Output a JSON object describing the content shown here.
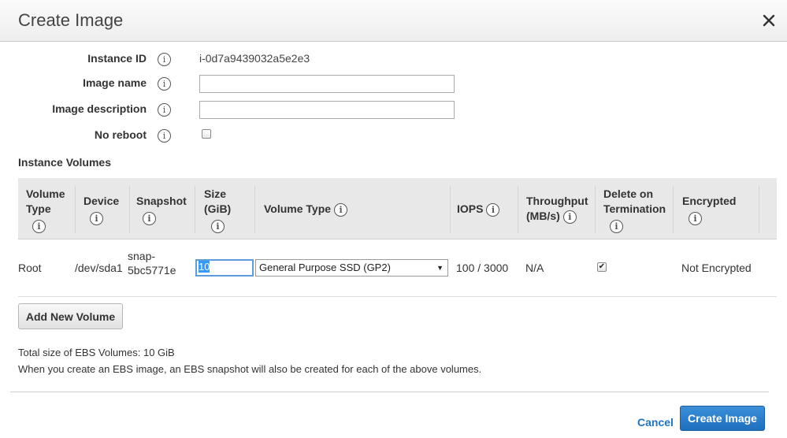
{
  "dialog": {
    "title": "Create Image"
  },
  "form": {
    "instance_id_label": "Instance ID",
    "instance_id_value": "i-0d7a9439032a5e2e3",
    "image_name_label": "Image name",
    "image_name_value": "",
    "image_description_label": "Image description",
    "image_description_value": "",
    "no_reboot_label": "No reboot",
    "no_reboot_checked": false
  },
  "volumes": {
    "section_title": "Instance Volumes",
    "headers": {
      "volume_type_1": "Volume",
      "volume_type_2": "Type",
      "device": "Device",
      "snapshot": "Snapshot",
      "size_1": "Size",
      "size_2": "(GiB)",
      "ebs_volume_type": "Volume Type",
      "iops": "IOPS",
      "throughput_1": "Throughput",
      "throughput_2": "(MB/s)",
      "delete_1": "Delete on",
      "delete_2": "Termination",
      "encrypted": "Encrypted"
    },
    "rows": [
      {
        "volume_type": "Root",
        "device": "/dev/sda1",
        "snapshot_1": "snap-",
        "snapshot_2": "5bc5771e",
        "size": "10",
        "ebs_volume_type": "General Purpose SSD (GP2)",
        "iops": "100 / 3000",
        "throughput": "N/A",
        "delete_on_termination": true,
        "encrypted": "Not Encrypted"
      }
    ],
    "add_button": "Add New Volume"
  },
  "notes": {
    "total_size": "Total size of EBS Volumes: 10 GiB",
    "snapshot_note": "When you create an EBS image, an EBS snapshot will also be created for each of the above volumes."
  },
  "footer": {
    "cancel_label": "Cancel",
    "create_label": "Create Image"
  },
  "colors": {
    "link": "#1e73be",
    "primary_button": "#2a7dcc",
    "header_bg": "#f3f3f3",
    "table_header_bg": "#e8e8e8"
  },
  "icons": {
    "close": "close-icon",
    "info": "info-icon",
    "dropdown": "chevron-down-icon",
    "checkmark": "checkmark-icon"
  }
}
